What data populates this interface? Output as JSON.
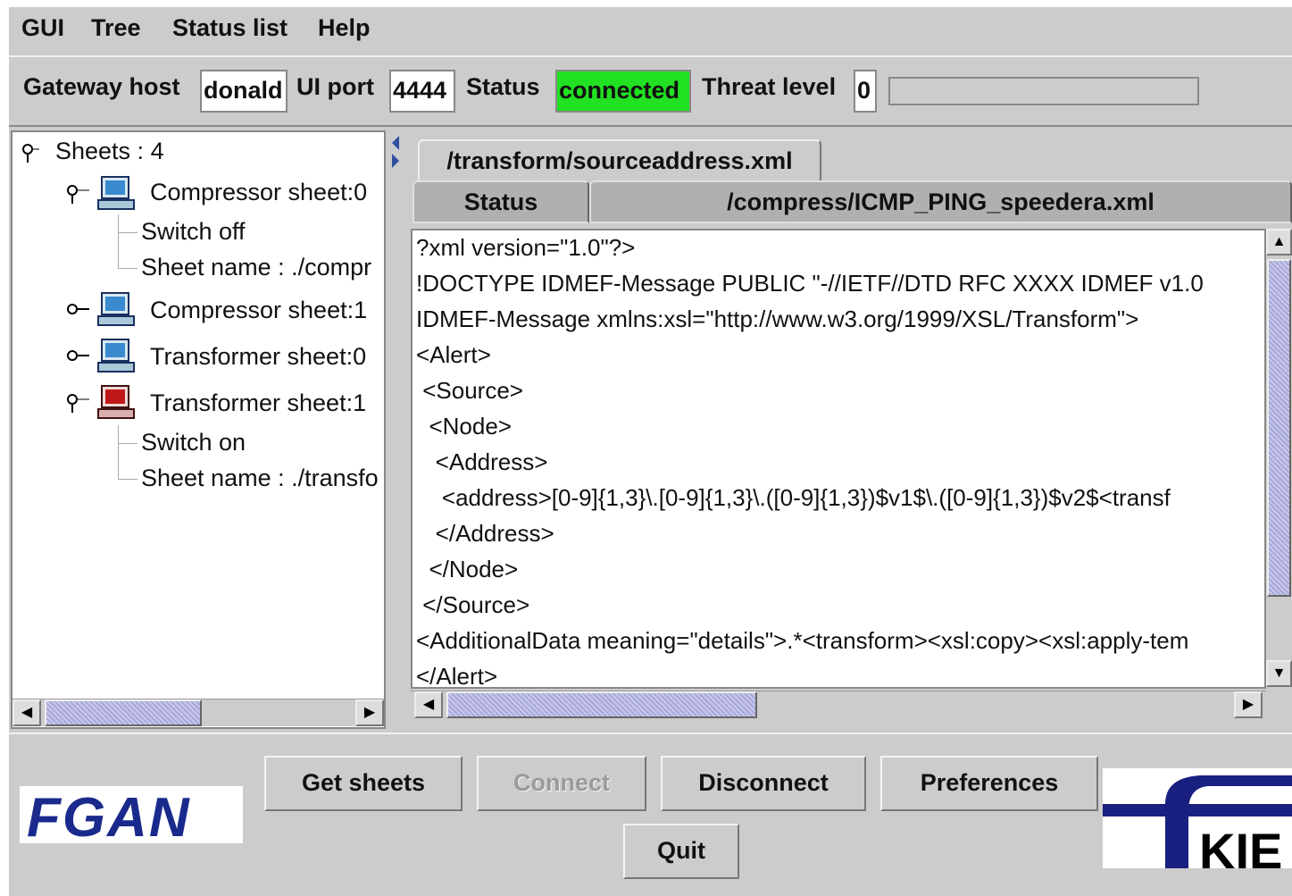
{
  "menu": [
    "GUI",
    "Tree",
    "Status list",
    "Help"
  ],
  "toolbar": {
    "gateway_label": "Gateway host",
    "gateway_value": "donald",
    "port_label": "UI port",
    "port_value": "4444",
    "status_label": "Status",
    "status_value": "connected",
    "status_color": "#22e022",
    "threat_label": "Threat level",
    "threat_value": "0",
    "threat_progress": 0
  },
  "tree": {
    "root": "Sheets : 4",
    "items": [
      {
        "label": "Compressor sheet:0",
        "icon": "computer-blue-icon",
        "expanded": true,
        "children": [
          "Switch off",
          "Sheet name : ./compr"
        ]
      },
      {
        "label": "Compressor sheet:1",
        "icon": "computer-blue-icon",
        "expanded": false
      },
      {
        "label": "Transformer sheet:0",
        "icon": "computer-blue-icon",
        "expanded": false
      },
      {
        "label": "Transformer sheet:1",
        "icon": "computer-red-icon",
        "expanded": true,
        "children": [
          "Switch on",
          "Sheet name : ./transfo"
        ]
      }
    ]
  },
  "tabs": {
    "top": "/transform/sourceaddress.xml",
    "status": "Status",
    "compress": "/compress/ICMP_PING_speedera.xml"
  },
  "editor_lines": [
    "?xml version=\"1.0\"?>",
    "!DOCTYPE IDMEF-Message PUBLIC \"-//IETF//DTD RFC XXXX IDMEF v1.0",
    "IDMEF-Message xmlns:xsl=\"http://www.w3.org/1999/XSL/Transform\">",
    "<Alert>",
    " <Source>",
    "  <Node>",
    "   <Address>",
    "    <address>[0-9]{1,3}\\.[0-9]{1,3}\\.([0-9]{1,3})$v1$\\.([0-9]{1,3})$v2$<transf",
    "   </Address>",
    "  </Node>",
    " </Source>",
    "<AdditionalData meaning=\"details\">.*<transform><xsl:copy><xsl:apply-tem",
    "</Alert>"
  ],
  "buttons": {
    "get_sheets": "Get sheets",
    "connect": "Connect",
    "disconnect": "Disconnect",
    "preferences": "Preferences",
    "quit": "Quit"
  },
  "logos": {
    "fgan": "FGAN",
    "kie": "KIE"
  }
}
